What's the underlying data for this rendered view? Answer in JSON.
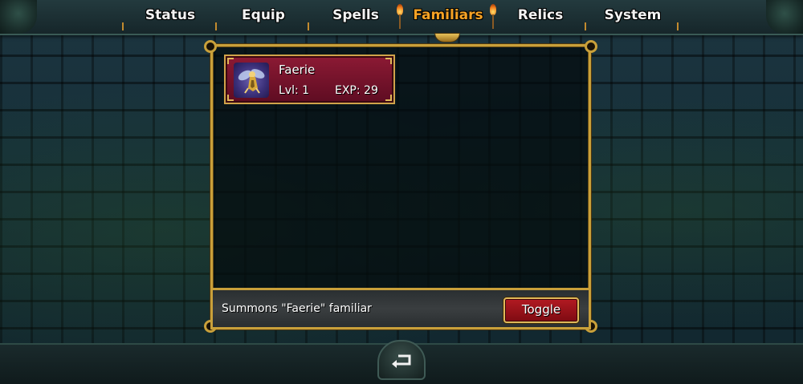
{
  "tabs": [
    {
      "label": "Status",
      "active": false
    },
    {
      "label": "Equip",
      "active": false
    },
    {
      "label": "Spells",
      "active": false
    },
    {
      "label": "Familiars",
      "active": true
    },
    {
      "label": "Relics",
      "active": false
    },
    {
      "label": "System",
      "active": false
    }
  ],
  "colors": {
    "active_tab": "#f7a325",
    "inactive_tab": "#f2f2f2",
    "card_bg": "#8c1a34",
    "frame_gold": "#c9a03a",
    "toggle_bg": "#b21a22"
  },
  "familiars": [
    {
      "name": "Faerie",
      "level_text": "Lvl: 1",
      "exp_text": "EXP: 29",
      "portrait_icon": "faerie-portrait-icon"
    }
  ],
  "description": {
    "text": "Summons \"Faerie\" familiar",
    "toggle_label": "Toggle"
  },
  "bottom": {
    "back_icon": "return-arrow-icon"
  }
}
